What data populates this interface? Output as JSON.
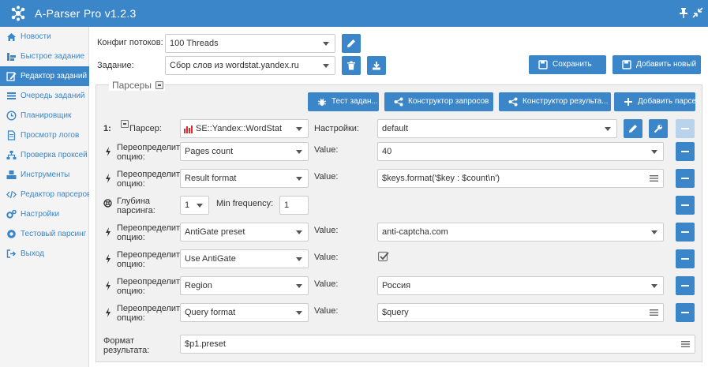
{
  "app": {
    "title": "A-Parser Pro v1.2.3"
  },
  "sidebar": {
    "items": [
      {
        "label": "Новости",
        "icon": "home-icon",
        "active": false
      },
      {
        "label": "Быстрое задание",
        "icon": "quick-task-icon",
        "active": false
      },
      {
        "label": "Редактор заданий",
        "icon": "edit-icon",
        "active": true
      },
      {
        "label": "Очередь заданий",
        "icon": "list-icon",
        "active": false
      },
      {
        "label": "Планировщик",
        "icon": "clock-icon",
        "active": false
      },
      {
        "label": "Просмотр логов",
        "icon": "file-icon",
        "active": false
      },
      {
        "label": "Проверка проксей",
        "icon": "sitemap-icon",
        "active": false
      },
      {
        "label": "Инструменты",
        "icon": "cubes-icon",
        "active": false
      },
      {
        "label": "Редактор парсеров",
        "icon": "code-icon",
        "active": false
      },
      {
        "label": "Настройки",
        "icon": "cogs-icon",
        "active": false
      },
      {
        "label": "Тестовый парсинг",
        "icon": "cog-circle-icon",
        "active": false
      },
      {
        "label": "Выход",
        "icon": "sign-out-icon",
        "active": false
      }
    ]
  },
  "config": {
    "threads_label": "Конфиг потоков:",
    "threads_value": "100 Threads",
    "task_label": "Задание:",
    "task_value": "Сбор слов из wordstat.yandex.ru",
    "save_label": "Сохранить",
    "add_new_label": "Добавить новый"
  },
  "parsers": {
    "title": "Парсеры",
    "buttons": {
      "test": "Тест задан...",
      "query_builder": "Конструктор запросов",
      "result_builder": "Конструктор результа...",
      "add_parser": "Добавить парсер"
    },
    "parser_row": {
      "index": "1:",
      "parser_label": "Парсер:",
      "parser_value": "SE::Yandex::WordStat",
      "settings_label": "Настройки:",
      "settings_value": "default"
    },
    "override_label_1": "Переопределить",
    "override_label_2": "опцию:",
    "value_label": "Value:",
    "overrides": [
      {
        "option": "Pages count",
        "value": "40",
        "kind": "select"
      },
      {
        "option": "Result format",
        "value": "$keys.format('$key : $count\\n')",
        "kind": "text"
      },
      {
        "option": "AntiGate preset",
        "value": "anti-captcha.com",
        "kind": "select"
      },
      {
        "option": "Use AntiGate",
        "value": "",
        "kind": "checkbox",
        "checked": true
      },
      {
        "option": "Region",
        "value": "Россия",
        "kind": "select"
      },
      {
        "option": "Query format",
        "value": "$query",
        "kind": "text"
      }
    ],
    "depth": {
      "label_1": "Глубина",
      "label_2": "парсинга:",
      "value": "1",
      "min_freq_label": "Min frequency:",
      "min_freq_value": "1"
    },
    "result_format": {
      "label_1": "Формат",
      "label_2": "результата:",
      "value": "$p1.preset"
    }
  },
  "colors": {
    "accent": "#3b86c8",
    "panel_bg": "#f1f1f1",
    "chart_icon": "#d9302f"
  }
}
